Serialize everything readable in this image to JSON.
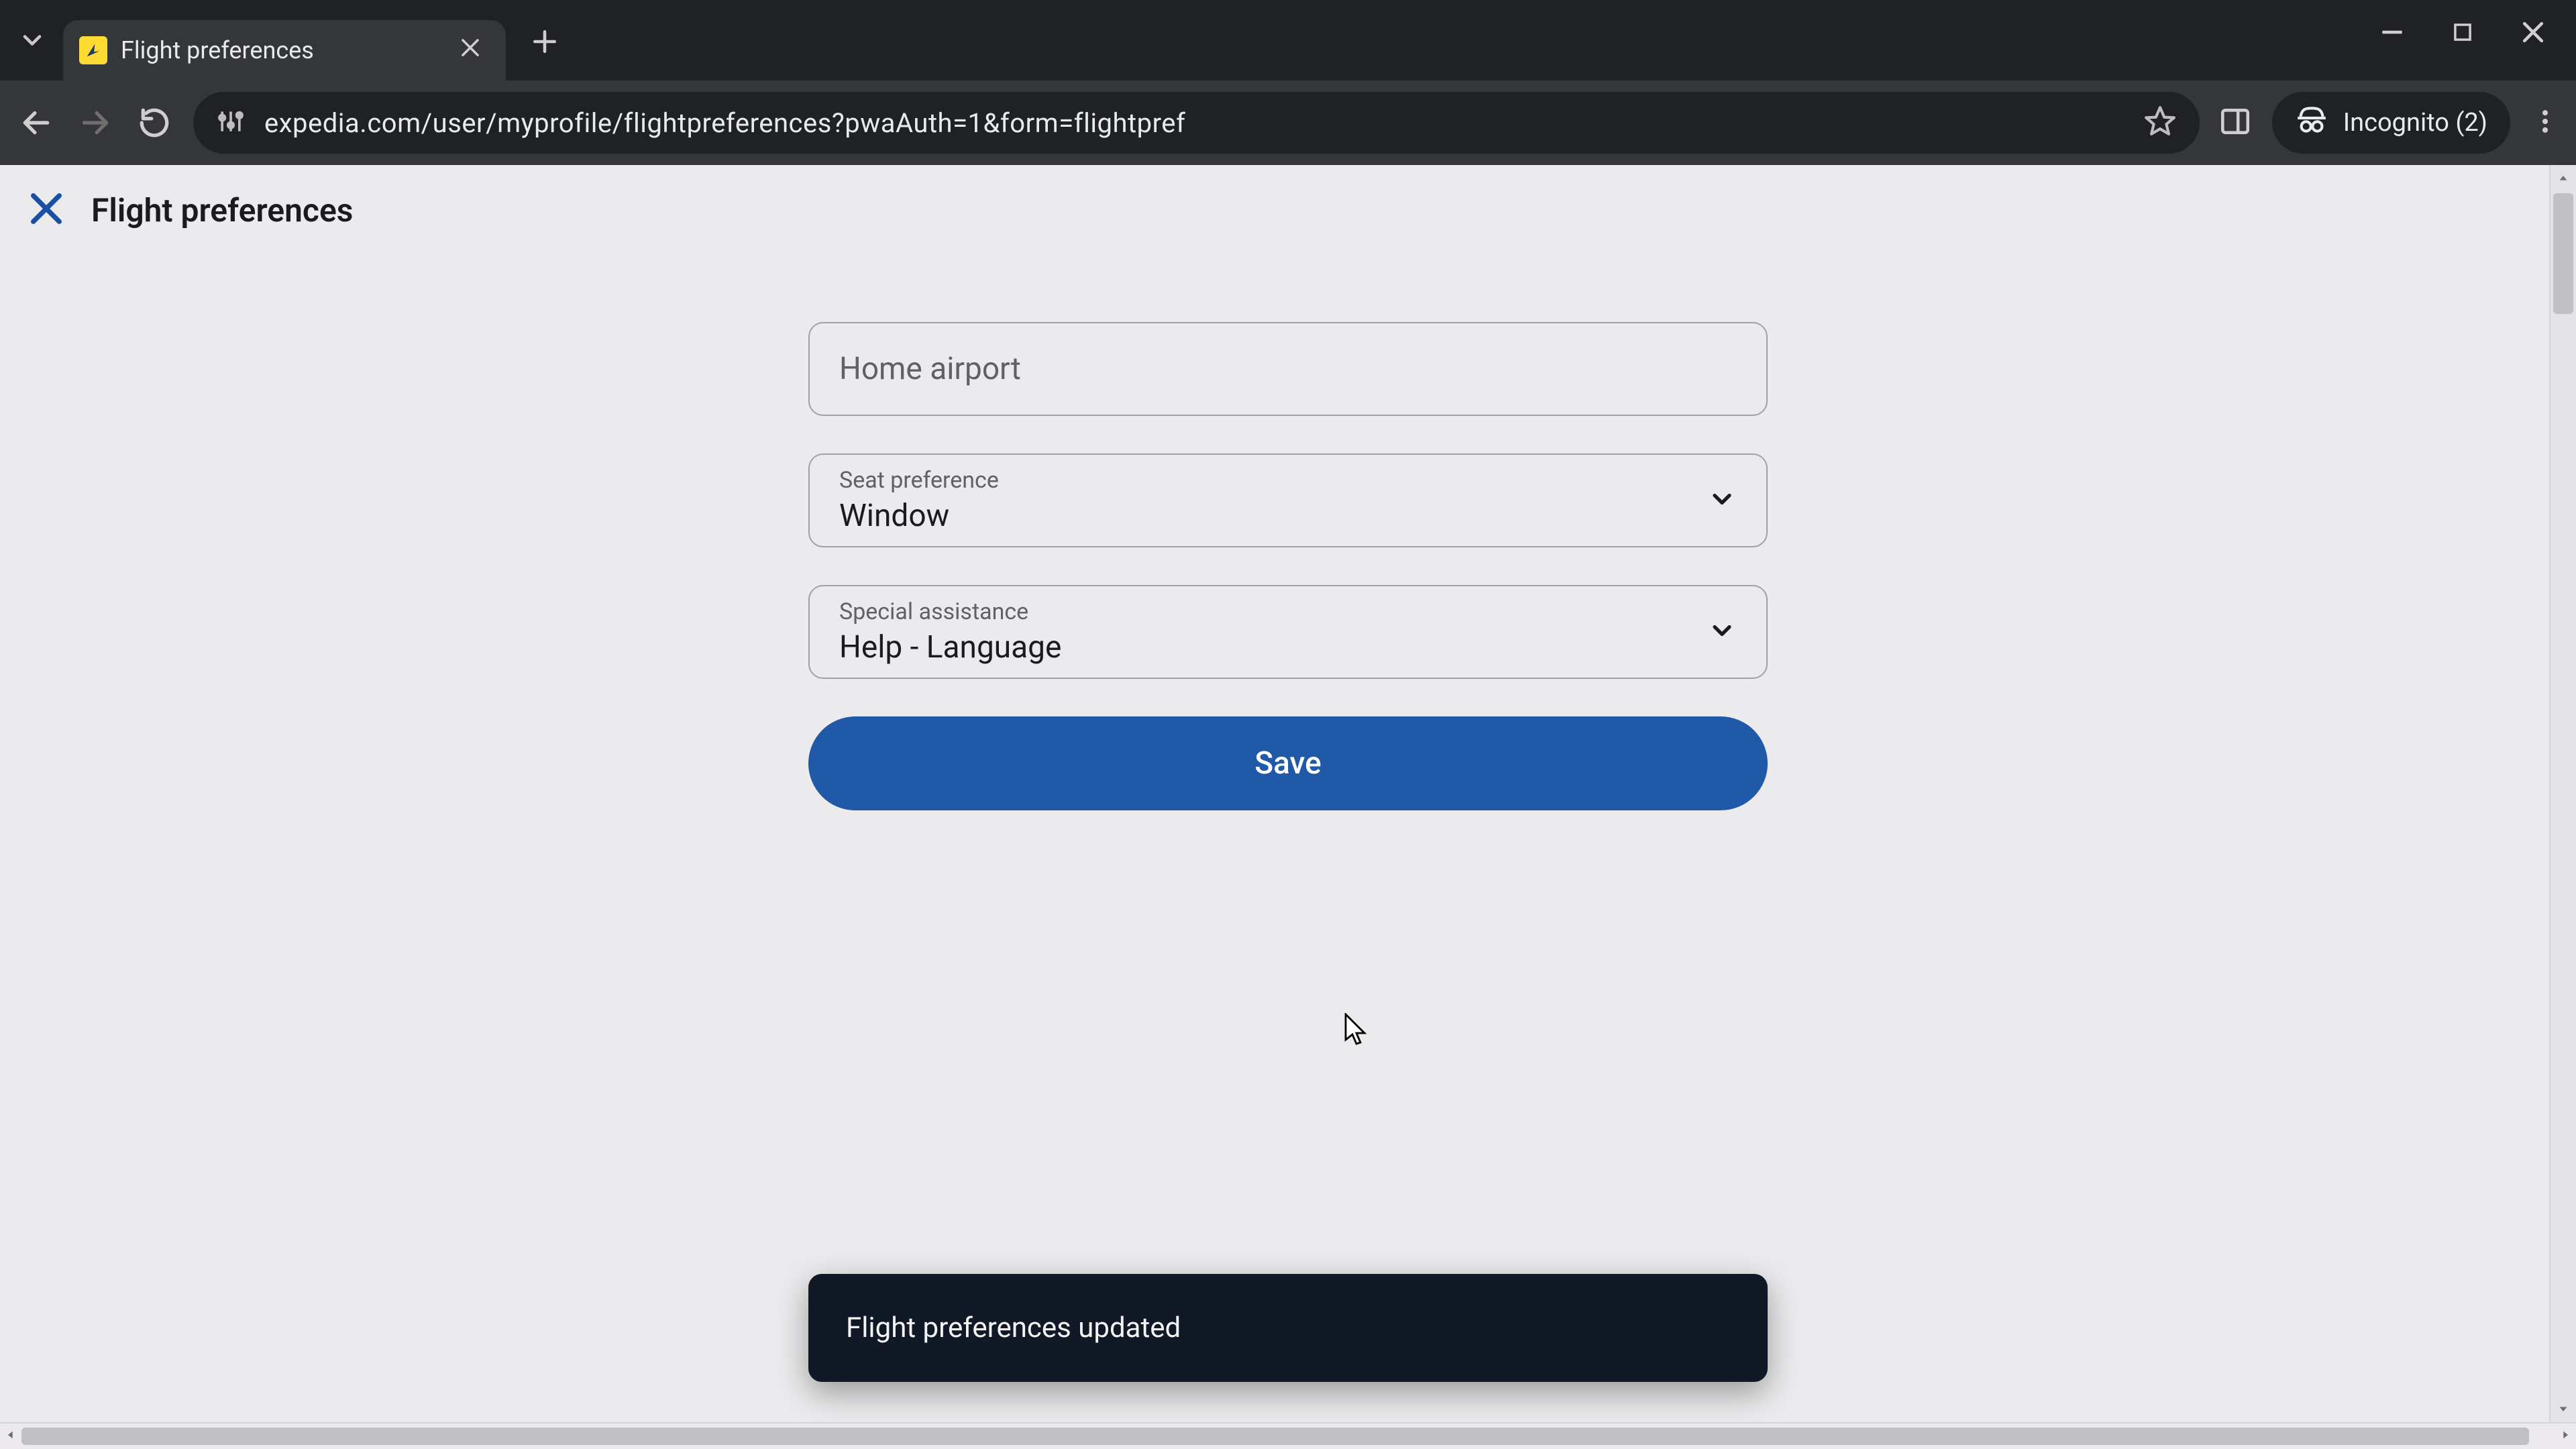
{
  "browser": {
    "tab_title": "Flight preferences",
    "url": "expedia.com/user/myprofile/flightpreferences?pwaAuth=1&form=flightpref",
    "incognito_label": "Incognito (2)"
  },
  "page": {
    "title": "Flight preferences"
  },
  "form": {
    "home_airport": {
      "placeholder": "Home airport",
      "value": ""
    },
    "seat_preference": {
      "label": "Seat preference",
      "value": "Window"
    },
    "special_assistance": {
      "label": "Special assistance",
      "value": "Help - Language"
    },
    "save_label": "Save"
  },
  "toast": {
    "message": "Flight preferences updated"
  },
  "colors": {
    "accent": "#1f59a8",
    "page_bg": "#ebebed",
    "toast_bg": "#111826"
  }
}
